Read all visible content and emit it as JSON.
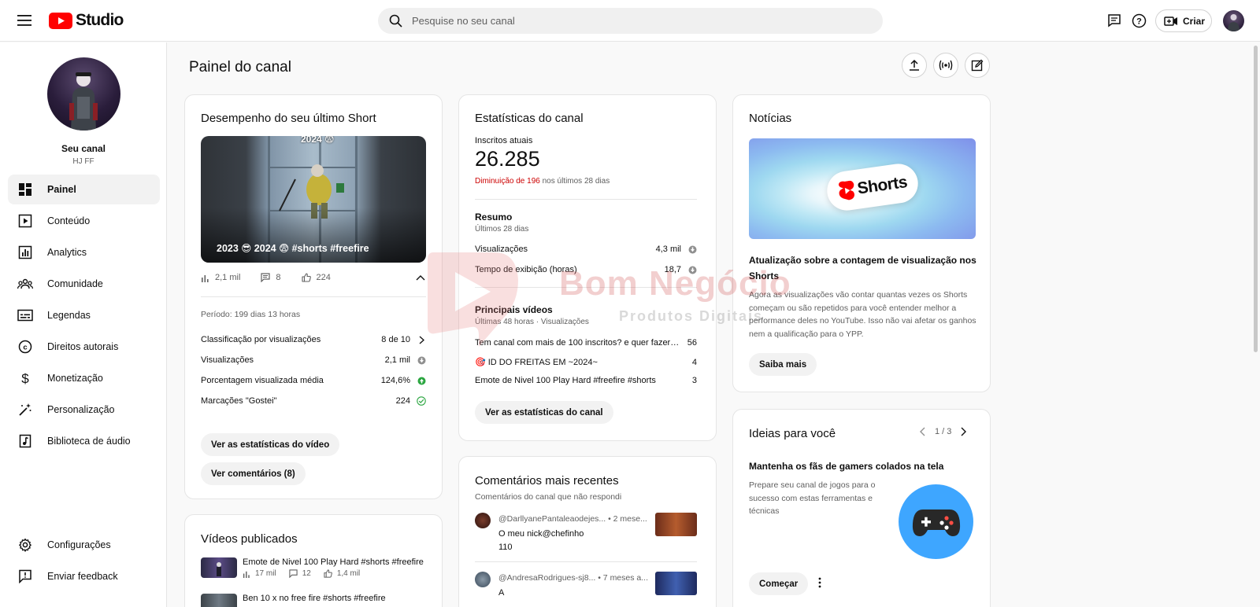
{
  "header": {
    "logo_text": "Studio",
    "search_placeholder": "Pesquise no seu canal",
    "create_label": "Criar"
  },
  "sidebar": {
    "channel_name": "Seu canal",
    "channel_handle": "HJ FF",
    "items": [
      {
        "label": "Painel",
        "icon": "dashboard-icon"
      },
      {
        "label": "Conteúdo",
        "icon": "content-icon"
      },
      {
        "label": "Analytics",
        "icon": "analytics-icon"
      },
      {
        "label": "Comunidade",
        "icon": "community-icon"
      },
      {
        "label": "Legendas",
        "icon": "subtitles-icon"
      },
      {
        "label": "Direitos autorais",
        "icon": "copyright-icon"
      },
      {
        "label": "Monetização",
        "icon": "monetization-icon"
      },
      {
        "label": "Personalização",
        "icon": "customization-icon"
      },
      {
        "label": "Biblioteca de áudio",
        "icon": "audio-library-icon"
      }
    ],
    "bottom_items": [
      {
        "label": "Configurações",
        "icon": "gear-icon"
      },
      {
        "label": "Enviar feedback",
        "icon": "feedback-icon"
      }
    ]
  },
  "main": {
    "page_title": "Painel do canal"
  },
  "last_short": {
    "title": "Desempenho do seu último Short",
    "thumb_caption": "2023 😎 2024 😨 #shorts #freefire",
    "thumb_top": "2024 😨",
    "views": "2,1 mil",
    "comments": "8",
    "likes": "224",
    "period": "Período: 199 dias 13 horas",
    "stats": [
      {
        "label": "Classificação por visualizações",
        "value": "8 de 10"
      },
      {
        "label": "Visualizações",
        "value": "2,1 mil"
      },
      {
        "label": "Porcentagem visualizada média",
        "value": "124,6%"
      },
      {
        "label": "Marcações \"Gostei\"",
        "value": "224"
      }
    ],
    "btn_stats": "Ver as estatísticas do vídeo",
    "btn_comments": "Ver comentários (8)"
  },
  "published": {
    "title": "Vídeos publicados",
    "videos": [
      {
        "title": "Emote de Nivel 100 Play Hard #shorts #freefire",
        "views": "17 mil",
        "comments": "12",
        "likes": "1,4 mil"
      },
      {
        "title": "Ben 10 x no free fire #shorts #freefire"
      }
    ]
  },
  "channel_stats": {
    "title": "Estatísticas do canal",
    "subs_label": "Inscritos atuais",
    "subs_value": "26.285",
    "change_neg": "Diminuição de 196",
    "change_rest": " nos últimos 28 dias",
    "summary_title": "Resumo",
    "summary_sub": "Últimos 28 dias",
    "summary": [
      {
        "label": "Visualizações",
        "value": "4,3 mil"
      },
      {
        "label": "Tempo de exibição (horas)",
        "value": "18,7"
      }
    ],
    "top_title": "Principais vídeos",
    "top_sub": "Últimas 48 horas · Visualizações",
    "top_videos": [
      {
        "label": "Tem canal com mais de 100 inscritos? e quer fazer at...",
        "value": "56"
      },
      {
        "label": "🎯 ID DO FREITAS EM ~2024~",
        "value": "4"
      },
      {
        "label": "Emote de Nivel 100 Play Hard #freefire #shorts",
        "value": "3"
      }
    ],
    "btn": "Ver as estatísticas do canal"
  },
  "comments": {
    "title": "Comentários mais recentes",
    "sub": "Comentários do canal que não respondi",
    "items": [
      {
        "author": "@DarllyanePantaleaodejes... • 2 mese...",
        "line1": "O meu nick@chefinho",
        "line2": "110"
      },
      {
        "author": "@AndresaRodrigues-sj8... • 7 meses a...",
        "line1": "A"
      }
    ]
  },
  "news": {
    "title": "Notícias",
    "banner_text": "Shorts",
    "headline": "Atualização sobre a contagem de visualização nos Shorts",
    "body": "Agora as visualizações vão contar quantas vezes os Shorts começam ou são repetidos para você entender melhor a performance deles no YouTube. Isso não vai afetar os ganhos nem a qualificação para o YPP.",
    "btn": "Saiba mais"
  },
  "ideas": {
    "title": "Ideias para você",
    "pager": "1 / 3",
    "headline": "Mantenha os fãs de gamers colados na tela",
    "body": "Prepare seu canal de jogos para o sucesso com estas ferramentas e técnicas",
    "btn": "Começar"
  },
  "watermark": {
    "text": "Bom Negócio",
    "sub": "Produtos Digitais"
  },
  "colors": {
    "brand_red": "#ff0000",
    "negative": "#cc0000",
    "positive": "#2ba640",
    "accent_blue": "#3ea6ff"
  }
}
